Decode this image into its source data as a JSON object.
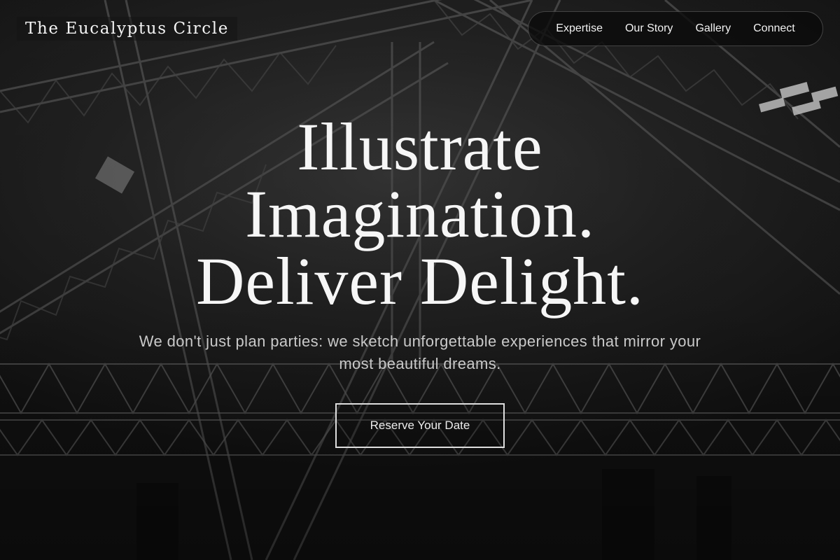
{
  "brand": {
    "name": "The Eucalyptus Circle"
  },
  "nav": {
    "items": [
      {
        "label": "Expertise"
      },
      {
        "label": "Our Story"
      },
      {
        "label": "Gallery"
      },
      {
        "label": "Connect"
      }
    ]
  },
  "hero": {
    "title_lines": [
      "Illustrate",
      "Imagination.",
      "Deliver Delight."
    ],
    "subtitle": "We don't just plan parties: we sketch unforgettable experiences that mirror your most beautiful dreams.",
    "cta_label": "Reserve Your Date"
  },
  "colors": {
    "background": "#161616",
    "text": "#f2f2f2",
    "subtitle": "#c9c9c9",
    "nav_background": "#0a0a0a"
  },
  "background_image": {
    "icon": "stage-truss-photo"
  }
}
